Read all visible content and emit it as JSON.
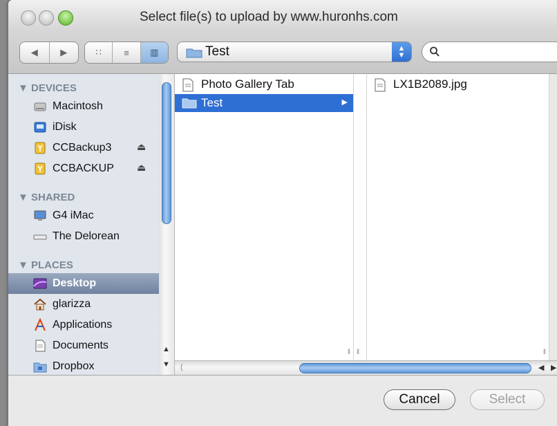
{
  "window": {
    "title": "Select file(s) to upload by www.huronhs.com"
  },
  "toolbar": {
    "back_glyph": "◀",
    "forward_glyph": "▶",
    "view_modes": [
      {
        "name": "icon-view",
        "glyph": "∷"
      },
      {
        "name": "list-view",
        "glyph": "≡"
      },
      {
        "name": "column-view",
        "glyph": "▥"
      }
    ],
    "location": "Test",
    "search": {
      "value": "",
      "placeholder": ""
    }
  },
  "sidebar": {
    "sections": [
      {
        "title": "▼ DEVICES",
        "items": [
          {
            "label": "Macintosh",
            "icon": "hard-drive-icon",
            "eject": false
          },
          {
            "label": "iDisk",
            "icon": "idisk-icon",
            "eject": false
          },
          {
            "label": "CCBackup3",
            "icon": "external-drive-icon",
            "eject": true
          },
          {
            "label": "CCBACKUP",
            "icon": "external-drive-icon",
            "eject": true
          }
        ]
      },
      {
        "title": "▼ SHARED",
        "items": [
          {
            "label": "G4 iMac",
            "icon": "computer-icon",
            "eject": false
          },
          {
            "label": "The Delorean",
            "icon": "network-drive-icon",
            "eject": false
          }
        ]
      },
      {
        "title": "▼ PLACES",
        "items": [
          {
            "label": "Desktop",
            "icon": "desktop-icon",
            "selected": true
          },
          {
            "label": "glarizza",
            "icon": "home-icon"
          },
          {
            "label": "Applications",
            "icon": "applications-icon"
          },
          {
            "label": "Documents",
            "icon": "documents-icon"
          },
          {
            "label": "Dropbox",
            "icon": "folder-icon"
          }
        ]
      }
    ],
    "eject_glyph": "⏏"
  },
  "columns": {
    "col1": [
      {
        "label": "Photo Gallery Tab",
        "icon": "document-icon",
        "selected": false
      },
      {
        "label": "Test",
        "icon": "folder-icon",
        "selected": true
      }
    ],
    "col3": [
      {
        "label": "LX1B2089.jpg",
        "icon": "document-icon"
      }
    ]
  },
  "buttons": {
    "cancel": "Cancel",
    "select": "Select"
  },
  "colors": {
    "selection": "#2e6fd4",
    "sidebar_selection": "#6f82a0",
    "sidebar_bg": "#e1e6ed",
    "zoom_light": "#58b028"
  }
}
